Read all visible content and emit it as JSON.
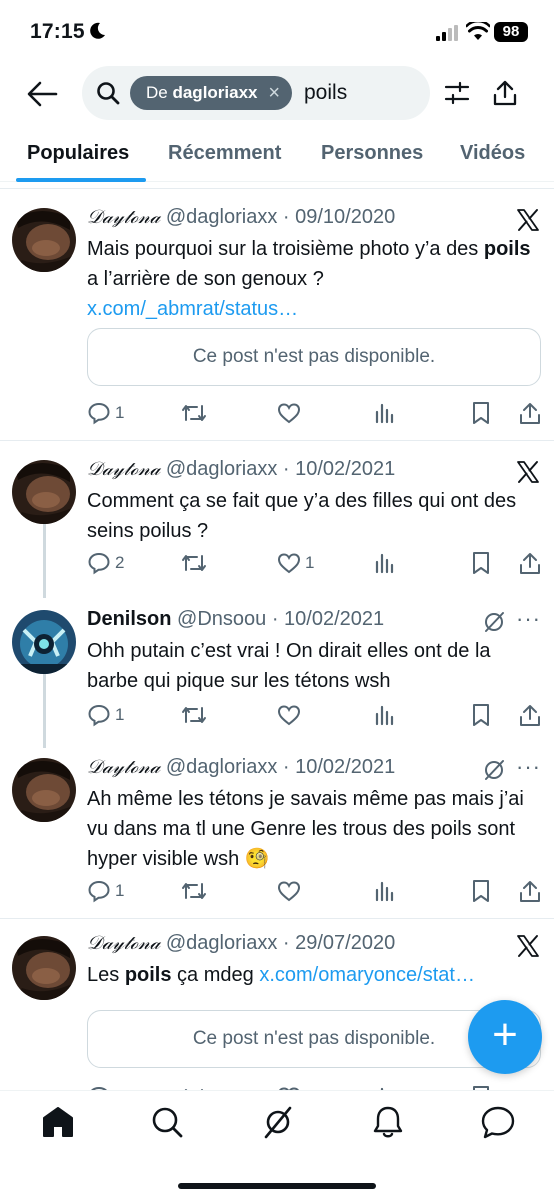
{
  "status_bar": {
    "time": "17:15",
    "battery": "98"
  },
  "search": {
    "chip_prefix": "De",
    "chip_user": "dagloriaxx",
    "query": "poils"
  },
  "tabs": [
    {
      "label": "Populaires",
      "active": true
    },
    {
      "label": "Récemment",
      "active": false
    },
    {
      "label": "Personnes",
      "active": false
    },
    {
      "label": "Vidéos",
      "active": false
    }
  ],
  "tweets": [
    {
      "name": "𝒟𝒶𝓎𝓉ℴ𝓃𝒶",
      "handle": "@dagloriaxx",
      "date": "· 09/10/2020",
      "text_before": "Mais pourquoi sur la troisième photo y’a des ",
      "text_bold": "poils",
      "text_after": " a l’arrière de son genoux ? ",
      "link": "x.com/_abmrat/status…",
      "unavailable": "Ce post n'est pas disponible.",
      "replies": "1",
      "retweets": "",
      "likes": ""
    },
    {
      "name": "𝒟𝒶𝓎𝓉ℴ𝓃𝒶",
      "handle": "@dagloriaxx",
      "date": "· 10/02/2021",
      "text": "Comment ça se fait que y’a des filles qui ont des seins poilus ?",
      "replies": "2",
      "retweets": "",
      "likes": "1"
    },
    {
      "name": "Denilson",
      "handle": "@Dnsoou",
      "date": "· 10/02/2021",
      "text": "Ohh putain c’est vrai ! On dirait elles ont de la barbe qui pique sur les tétons wsh",
      "replies": "1",
      "retweets": "",
      "likes": ""
    },
    {
      "name": "𝒟𝒶𝓎𝓉ℴ𝓃𝒶",
      "handle": "@dagloriaxx",
      "date": "· 10/02/2021",
      "text": "Ah même les tétons je savais même pas mais j’ai vu dans ma tl une Genre les trous des poils sont hyper visible wsh 🧐",
      "replies": "1",
      "retweets": "",
      "likes": ""
    },
    {
      "name": "𝒟𝒶𝓎𝓉ℴ𝓃𝒶",
      "handle": "@dagloriaxx",
      "date": "· 29/07/2020",
      "text_before": "Les ",
      "text_bold": "poils",
      "text_after": " ça mdeg ",
      "link": "x.com/omaryonce/stat…",
      "unavailable": "Ce post n'est pas disponible."
    }
  ],
  "fab": {
    "label": "+"
  },
  "colors": {
    "accent": "#1d9bf0",
    "text": "#0f1419",
    "muted": "#536471"
  }
}
